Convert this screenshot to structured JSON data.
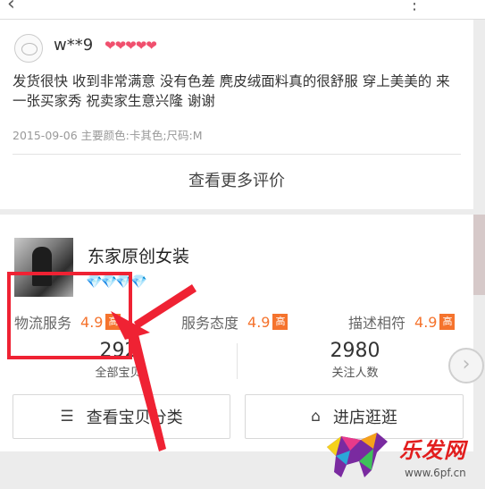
{
  "review": {
    "username": "w**9",
    "hearts": "❤❤❤❤❤",
    "text": "发货很快 收到非常满意 没有色差 麂皮绒面料真的很舒服 穿上美美的 来一张买家秀  祝卖家生意兴隆 谢谢",
    "meta": "2015-09-06 主要颜色:卡其色;尺码:M",
    "more_reviews_label": "查看更多评价"
  },
  "shop": {
    "name": "东家原创女装",
    "diamonds": "💎💎💎💎",
    "scores": [
      {
        "label": "物流服务",
        "value": "4.9",
        "badge": "高"
      },
      {
        "label": "服务态度",
        "value": "4.9",
        "badge": "高"
      },
      {
        "label": "描述相符",
        "value": "4.9",
        "badge": "高"
      }
    ],
    "stats": [
      {
        "value": "292",
        "label": "全部宝贝"
      },
      {
        "value": "2980",
        "label": "关注人数"
      }
    ],
    "buttons": {
      "category_label": "查看宝贝分类",
      "enter_label": "进店逛逛"
    }
  },
  "icons": {
    "category": "list-icon",
    "store": "store-icon",
    "next": "chevron-right-icon"
  },
  "colors": {
    "accent": "#f5732d",
    "annotation": "#ef2233",
    "hearts": "#f0506e",
    "diamonds": "#5fb6f5"
  },
  "watermark": {
    "brand": "乐发网",
    "url": "www.6pf.cn"
  }
}
